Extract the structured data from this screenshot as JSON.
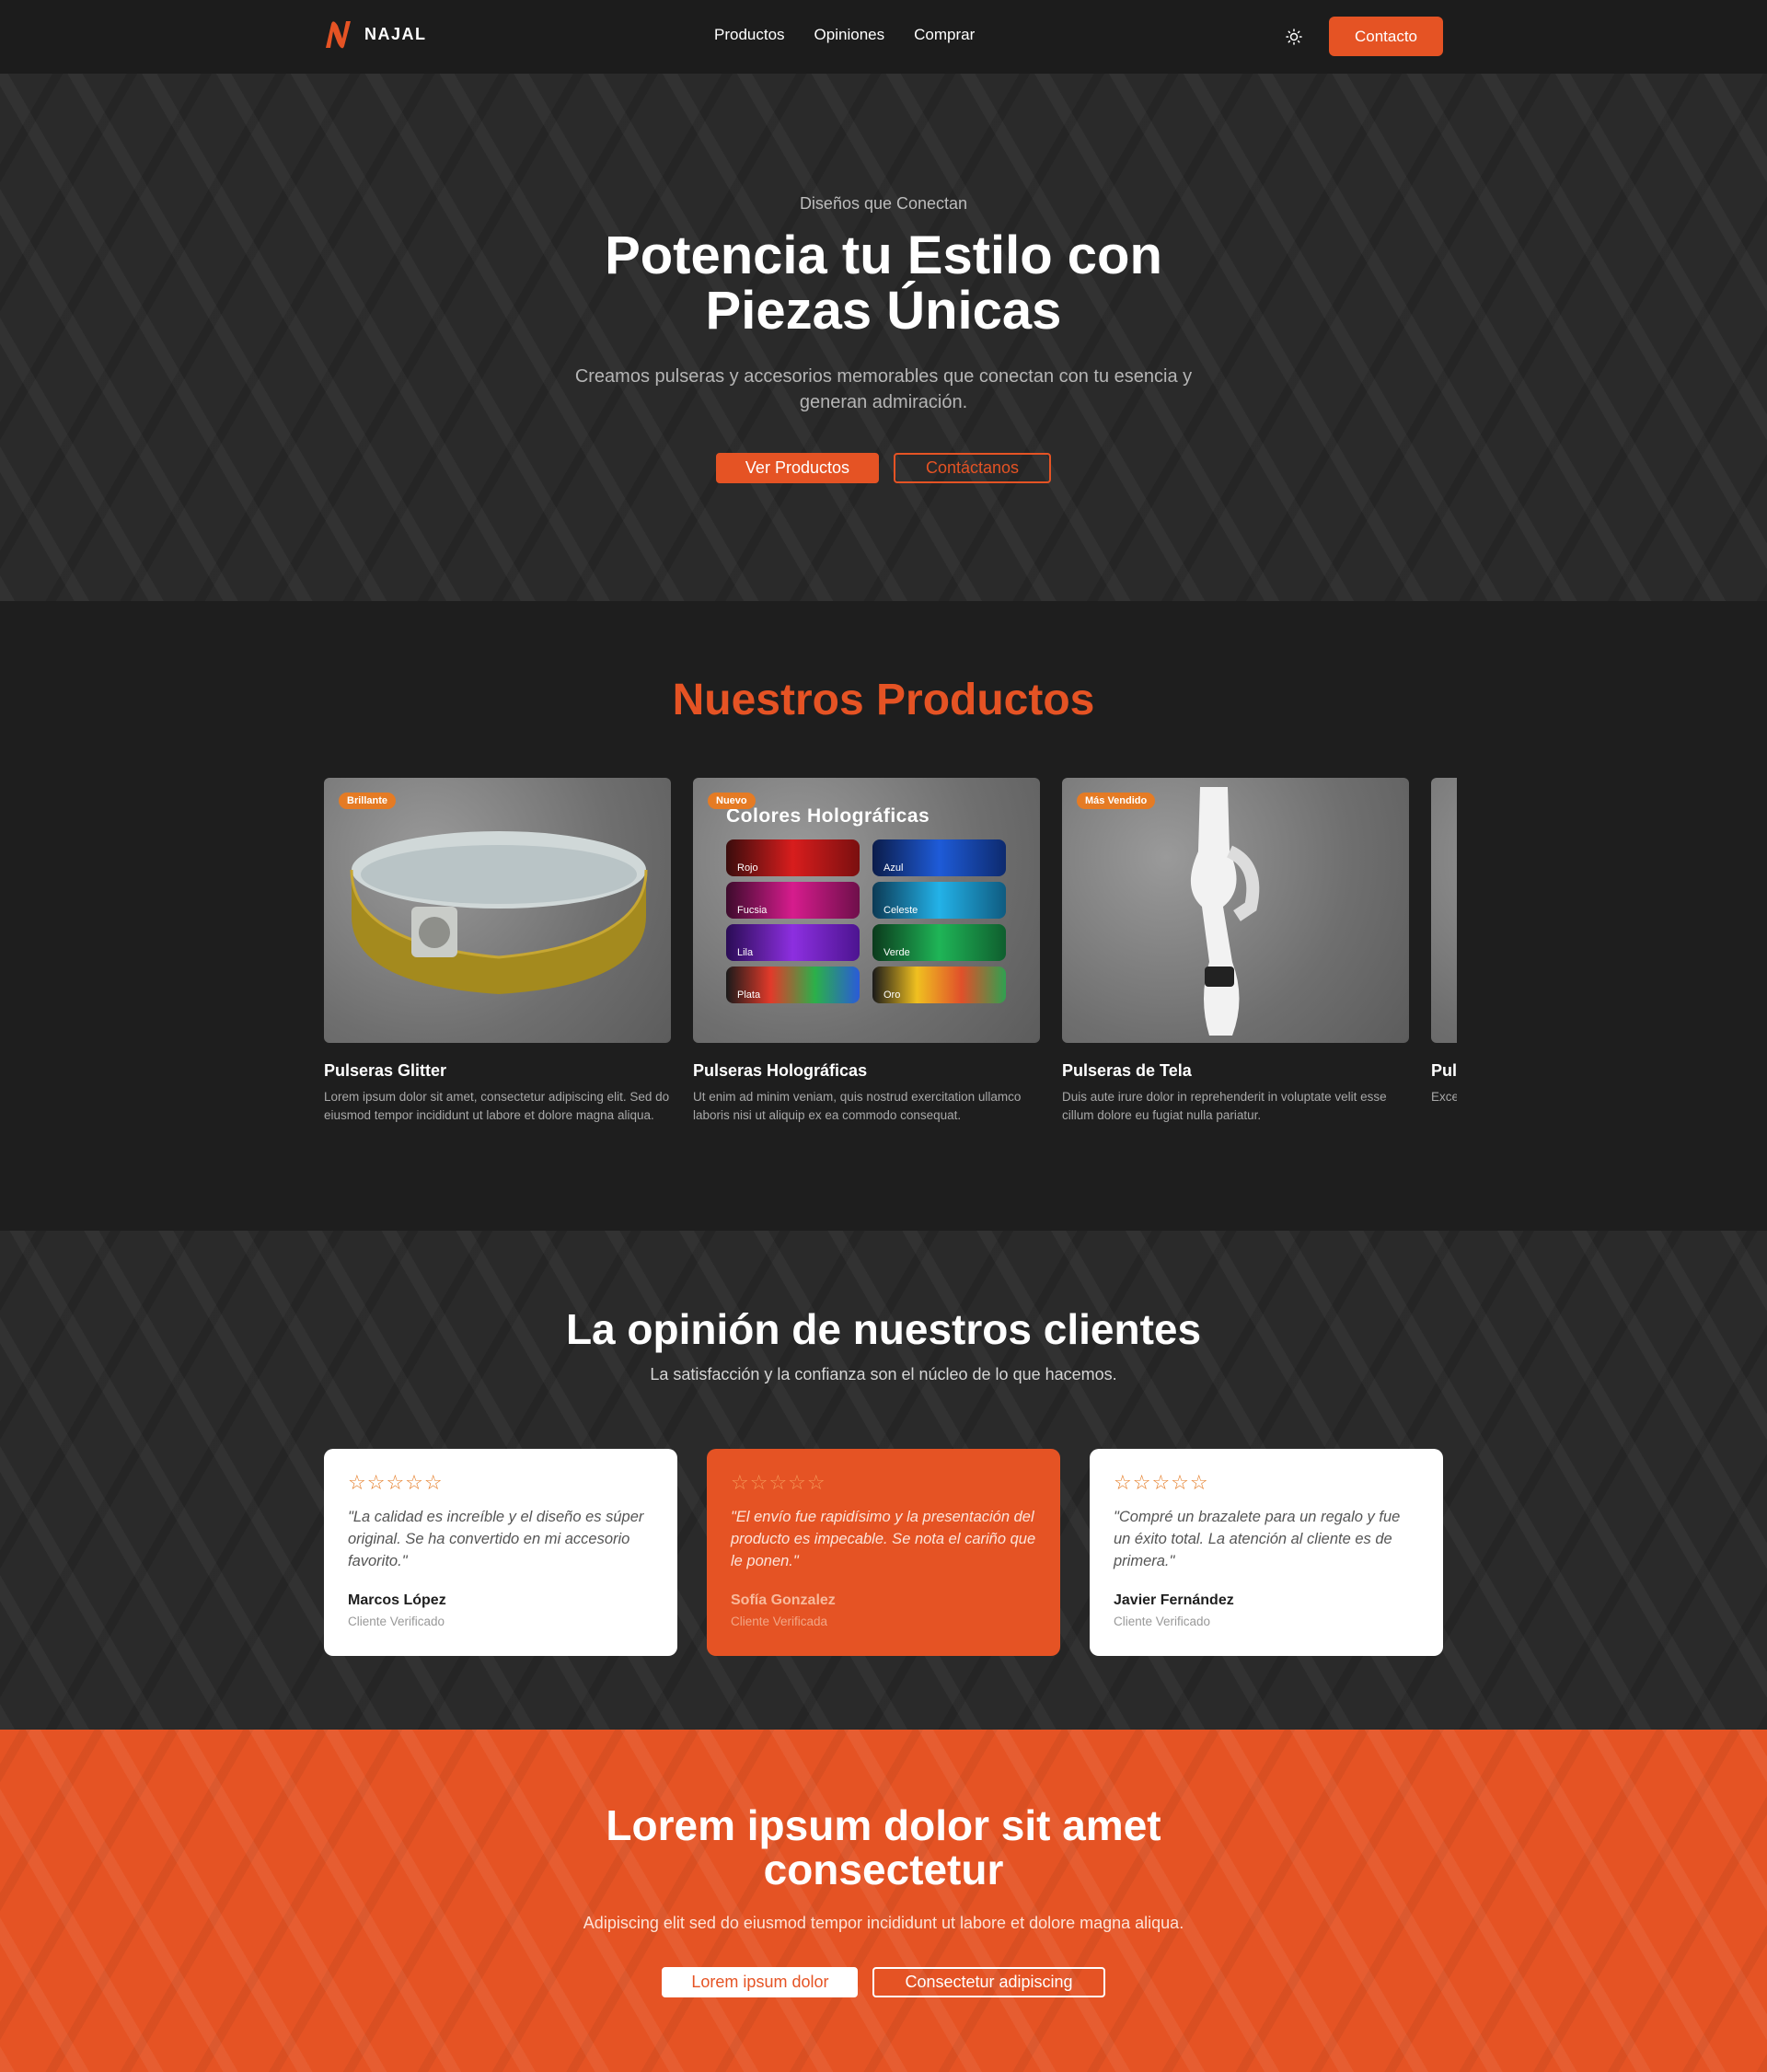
{
  "nav": {
    "brand": "NAJAL",
    "links": [
      "Productos",
      "Opiniones",
      "Comprar"
    ],
    "contact_label": "Contacto"
  },
  "hero": {
    "eyebrow": "Diseños que Conectan",
    "title": "Potencia tu Estilo con Piezas Únicas",
    "subtitle": "Creamos pulseras y accesorios memorables que conectan con tu esencia y generan admiración.",
    "primary_cta": "Ver Productos",
    "secondary_cta": "Contáctanos"
  },
  "products": {
    "title": "Nuestros Productos",
    "items": [
      {
        "badge": "Brillante",
        "name": "Pulseras Glitter",
        "description": "Lorem ipsum dolor sit amet, consectetur adipiscing elit. Sed do eiusmod tempor incididunt ut labore et dolore magna aliqua."
      },
      {
        "badge": "Nuevo",
        "name": "Pulseras Holográficas",
        "description": "Ut enim ad minim veniam, quis nostrud exercitation ullamco laboris nisi ut aliquip ex ea commodo consequat.",
        "image_title": "Colores Holográficas",
        "colors": [
          "Rojo",
          "Azul",
          "Fucsia",
          "Celeste",
          "Lila",
          "Verde",
          "Plata",
          "Oro"
        ]
      },
      {
        "badge": "Más Vendido",
        "name": "Pulseras de Tela",
        "description": "Duis aute irure dolor in reprehenderit in voluptate velit esse cillum dolore eu fugiat nulla pariatur."
      },
      {
        "name": "Puls",
        "description": "Exce in cu"
      }
    ]
  },
  "reviews": {
    "title": "La opinión de nuestros clientes",
    "subtitle": "La satisfacción y la confianza son el núcleo de lo que hacemos.",
    "stars": "☆☆☆☆☆",
    "items": [
      {
        "quote": "\"La calidad es increíble y el diseño es súper original. Se ha convertido en mi accesorio favorito.\"",
        "author": "Marcos López",
        "role": "Cliente Verificado"
      },
      {
        "quote": "\"El envío fue rapidísimo y la presentación del producto es impecable. Se nota el cariño que le ponen.\"",
        "author": "Sofía Gonzalez",
        "role": "Cliente Verificada"
      },
      {
        "quote": "\"Compré un brazalete para un regalo y fue un éxito total. La atención al cliente es de primera.\"",
        "author": "Javier Fernández",
        "role": "Cliente Verificado"
      }
    ]
  },
  "cta": {
    "title": "Lorem ipsum dolor sit amet consectetur",
    "subtitle": "Adipiscing elit sed do eiusmod tempor incididunt ut labore et dolore magna aliqua.",
    "primary": "Lorem ipsum dolor",
    "secondary": "Consectetur adipiscing"
  },
  "colors": {
    "accent": "#e55324",
    "badge": "#e57b24",
    "dark": "#1e1e1e"
  }
}
